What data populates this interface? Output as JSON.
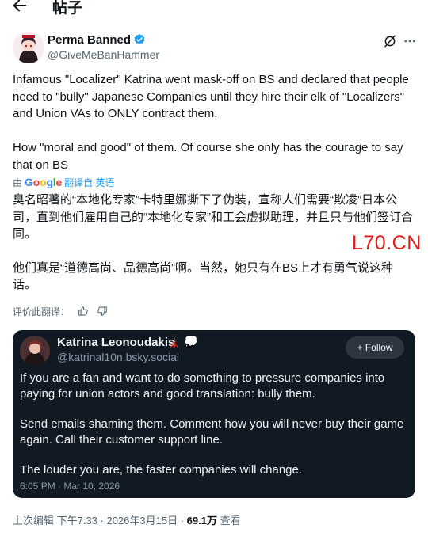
{
  "header": {
    "back_icon": "arrow-left-icon",
    "title": "帖子"
  },
  "author": {
    "name": "Perma Banned",
    "handle": "@GiveMeBanHammer",
    "verified_color": "#1d9bf0",
    "icons": [
      "verified-icon",
      "grok-icon",
      "more-icon"
    ]
  },
  "post": {
    "paragraphs": [
      "Infamous \"Localizer\" Katrina went mask-off on BS and declared that people need to \"bully\" Japanese Companies until they hire their elk of \"Localizers\" and Union VAs to ONLY contract them.",
      "How \"moral and good\" of them. Of course she only has the courage to say that on BS"
    ]
  },
  "translation": {
    "by": "由",
    "google": "Google",
    "link": "翻译自 英语",
    "paragraphs": [
      "臭名昭著的“本地化专家”卡特里娜撕下了伪装，宣称人们需要“欺凌”日本公司，直到他们雇用自己的“本地化专家”和工会虚拟助理，并且只与他们签订合同。",
      "他们真是“道德高尚、品德高尚”啊。当然，她只有在BS上才有勇气说这种话。"
    ],
    "rate_label": "评价此翻译：",
    "rate_icons": [
      "thumbs-up-icon",
      "thumbs-down-icon"
    ]
  },
  "watermark": "L70.CN",
  "embed": {
    "name": "Katrina Leonoudakis",
    "emoji": "🗼 💭",
    "handle": "@katrinal10n.bsky.social",
    "follow_label": "+ Follow",
    "paragraphs": [
      "If you are a fan and want to do something to pressure companies into paying for union actors and good translation: bully them.",
      "Send emails shaming them. Comment how you will never buy their game again. Call their customer support line.",
      "The louder you are, the faster companies will change."
    ],
    "date": "6:05 PM · Mar 10, 2026",
    "background": "#111923"
  },
  "meta": {
    "edited": "上次编辑 下午7:33 · 2026年3月15日 · ",
    "views": "69.1万",
    "views_suffix": " 查看"
  }
}
